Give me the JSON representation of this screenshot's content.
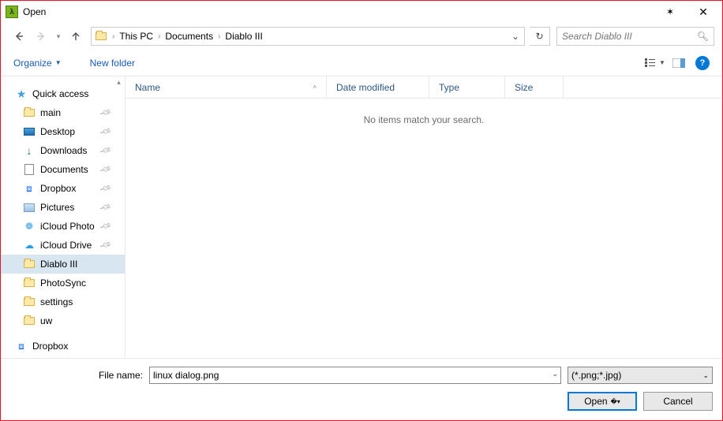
{
  "window": {
    "title": "Open"
  },
  "breadcrumb": {
    "items": [
      "This PC",
      "Documents",
      "Diablo III"
    ]
  },
  "search": {
    "placeholder": "Search Diablo III"
  },
  "toolbar": {
    "organize": "Organize",
    "newfolder": "New folder"
  },
  "columns": {
    "name": "Name",
    "date": "Date modified",
    "type": "Type",
    "size": "Size"
  },
  "main": {
    "empty": "No items match your search."
  },
  "sidebar": {
    "quick_access": "Quick access",
    "items": [
      {
        "label": "main",
        "icon": "folder",
        "pinned": true
      },
      {
        "label": "Desktop",
        "icon": "desktop",
        "pinned": true
      },
      {
        "label": "Downloads",
        "icon": "downloads",
        "pinned": true
      },
      {
        "label": "Documents",
        "icon": "documents",
        "pinned": true
      },
      {
        "label": "Dropbox",
        "icon": "dropbox",
        "pinned": true
      },
      {
        "label": "Pictures",
        "icon": "pictures",
        "pinned": true
      },
      {
        "label": "iCloud Photo",
        "icon": "icloud-photo",
        "pinned": true
      },
      {
        "label": "iCloud Drive",
        "icon": "icloud-drive",
        "pinned": true
      },
      {
        "label": "Diablo III",
        "icon": "folder",
        "pinned": false,
        "selected": true
      },
      {
        "label": "PhotoSync",
        "icon": "folder",
        "pinned": false
      },
      {
        "label": "settings",
        "icon": "folder",
        "pinned": false
      },
      {
        "label": "uw",
        "icon": "folder",
        "pinned": false
      }
    ],
    "dropbox_root": "Dropbox"
  },
  "footer": {
    "filename_label": "File name:",
    "filename_value": "linux dialog.png",
    "filetype": "(*.png;*.jpg)",
    "open": "Open",
    "cancel": "Cancel"
  }
}
